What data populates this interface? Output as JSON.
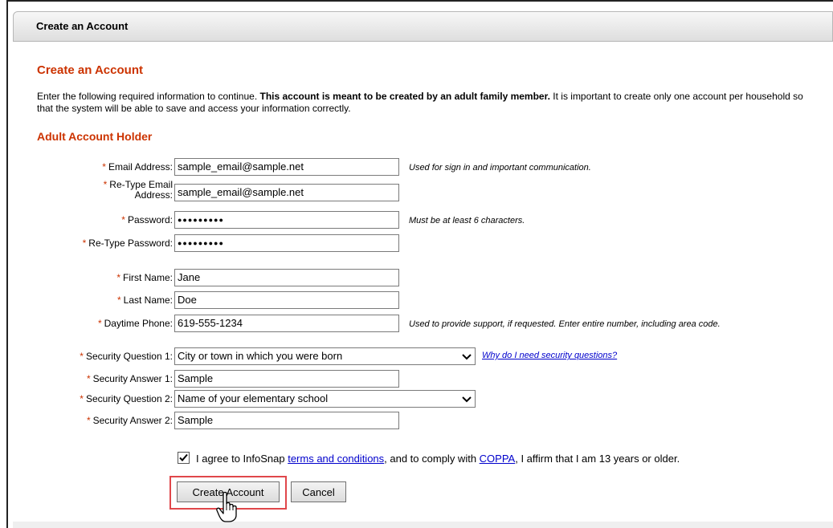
{
  "header": {
    "title": "Create an Account"
  },
  "section_title": "Create an Account",
  "intro": {
    "text_before": "Enter the following required information to continue. ",
    "bold_text": "This account is meant to be created by an adult family member.",
    "text_after": " It is important to create only one account per household so that the system will be able to save and access your information correctly."
  },
  "subsection_title": "Adult Account Holder",
  "required_marker": "*",
  "fields": {
    "email": {
      "label": "Email Address:",
      "value": "sample_email@sample.net",
      "hint": "Used for sign in and important communication."
    },
    "retype_email": {
      "label_line1": "Re-Type Email",
      "label_line2": "Address:",
      "value": "sample_email@sample.net"
    },
    "password": {
      "label": "Password:",
      "value": "●●●●●●●●●",
      "hint": "Must be at least 6 characters."
    },
    "retype_password": {
      "label": "Re-Type Password:",
      "value": "●●●●●●●●●"
    },
    "first_name": {
      "label": "First Name:",
      "value": "Jane"
    },
    "last_name": {
      "label": "Last Name:",
      "value": "Doe"
    },
    "phone": {
      "label": "Daytime Phone:",
      "value": "619-555-1234",
      "hint": "Used to provide support, if requested. Enter entire number, including area code."
    },
    "security_q1": {
      "label": "Security Question 1:",
      "value": "City or town in which you were born"
    },
    "security_a1": {
      "label": "Security Answer 1:",
      "value": "Sample"
    },
    "security_q2": {
      "label": "Security Question 2:",
      "value": "Name of your elementary school"
    },
    "security_a2": {
      "label": "Security Answer 2:",
      "value": "Sample"
    }
  },
  "security_link": "Why do I need security questions?",
  "agreement": {
    "checked": true,
    "text1": "I agree to InfoSnap ",
    "link1": "terms and conditions",
    "text2": ", and to comply with ",
    "link2": "COPPA",
    "text3": ", I affirm that I am 13 years or older."
  },
  "buttons": {
    "create": "Create Account",
    "cancel": "Cancel"
  },
  "colors": {
    "accent": "#cc3300",
    "link": "#0000cc",
    "highlight": "#e0474b"
  },
  "icons": [
    "chevron-down-icon",
    "checkmark-icon",
    "hand-pointer-icon"
  ]
}
